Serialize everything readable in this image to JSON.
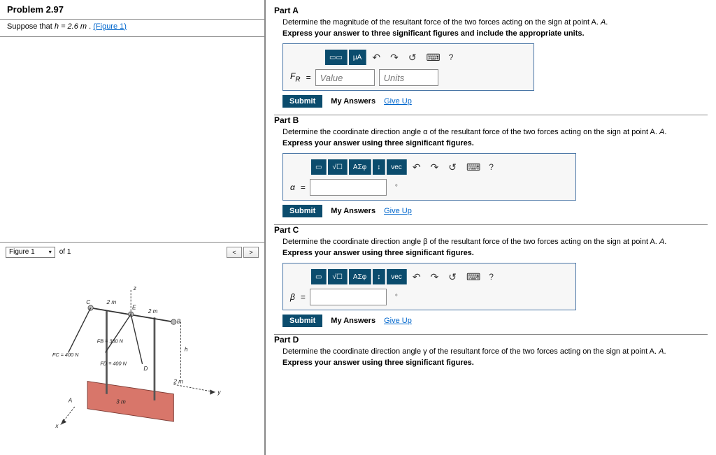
{
  "problem": {
    "title": "Problem 2.97",
    "suppose": "Suppose that ",
    "h_expr": "h = 2.6  m",
    "figure_link": "(Figure 1)"
  },
  "figure": {
    "selector": "Figure 1",
    "count": "of 1",
    "labels": {
      "C": "C",
      "E": "E",
      "B": "B",
      "D": "D",
      "A": "A",
      "z": "z",
      "y": "y",
      "x": "x",
      "h": "h",
      "d2a": "2 m",
      "d2b": "2 m",
      "d2c": "2 m",
      "d3": "3 m",
      "Fb": "FB = 350 N",
      "Fc": "FC = 400 N",
      "Fd": "FD = 400 N"
    }
  },
  "parts": {
    "A": {
      "title": "Part A",
      "desc": "Determine the magnitude of the resultant force of the two forces acting on the sign at point A.",
      "instr": "Express your answer to three significant figures and include the appropriate units.",
      "var": "F_R",
      "value_ph": "Value",
      "units_ph": "Units",
      "tb_mu": "μA"
    },
    "B": {
      "title": "Part B",
      "desc": "Determine the coordinate direction angle α of the resultant force of the two forces acting on the sign at point A.",
      "instr": "Express your answer using three significant figures.",
      "var": "α"
    },
    "C": {
      "title": "Part C",
      "desc": "Determine the coordinate direction angle β of the resultant force of the two forces acting on the sign at point A.",
      "instr": "Express your answer using three significant figures.",
      "var": "β"
    },
    "D": {
      "title": "Part D",
      "desc": "Determine the coordinate direction angle γ of the resultant force of the two forces acting on the sign at point A.",
      "instr": "Express your answer using three significant figures."
    }
  },
  "toolbar": {
    "root": "√☐",
    "greek": "ΑΣφ",
    "arrows": "↕",
    "vec": "vec",
    "undo": "↶",
    "redo": "↷",
    "reset": "↺",
    "keyboard": "⌨",
    "help": "?"
  },
  "buttons": {
    "submit": "Submit",
    "my_answers": "My Answers",
    "give_up": "Give Up"
  }
}
